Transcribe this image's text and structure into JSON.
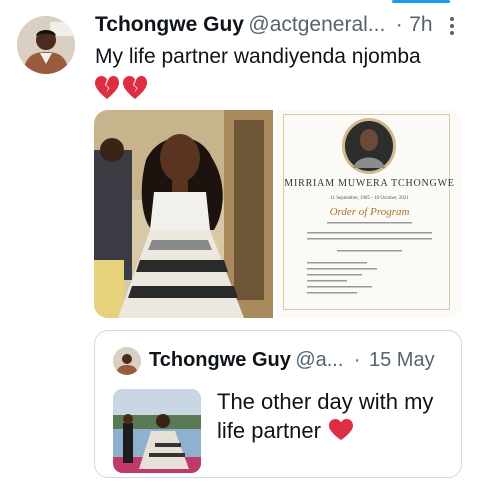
{
  "tweet": {
    "author_name": "Tchongwe Guy",
    "handle": "@actgeneral...",
    "separator": "·",
    "time": "7h",
    "text": "My life partner wandiyenda njomba",
    "emoji_icons": [
      "broken-heart-icon",
      "broken-heart-icon"
    ]
  },
  "media": {
    "program": {
      "title": "MIRRIAM MUWERA TCHONGWE",
      "dates": "11 September, 1985 - 10 October, 2021",
      "heading": "Order of Program"
    }
  },
  "quoted_tweet": {
    "author_name": "Tchongwe Guy",
    "handle": "@a...",
    "separator": "·",
    "time": "15 May",
    "text": "The other day with my life partner",
    "emoji_icon": "red-heart-icon"
  },
  "colors": {
    "accent": "#1d9bf0",
    "text": "#0f1419",
    "secondary_text": "#536471",
    "heart_red": "#e0245e",
    "border": "#cfd9de"
  }
}
